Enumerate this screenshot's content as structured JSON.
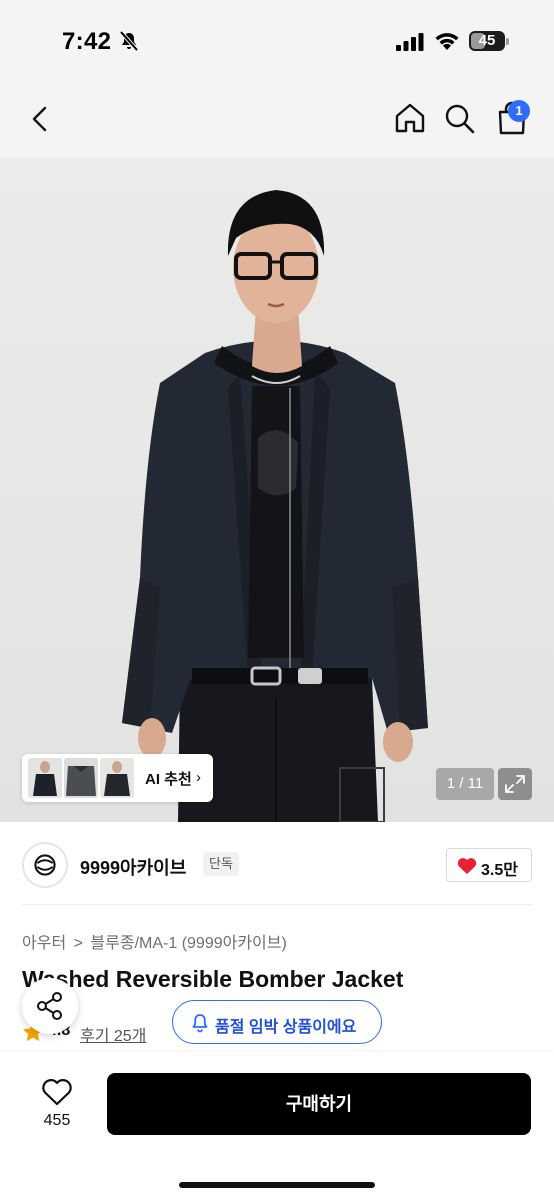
{
  "status_bar": {
    "time": "7:42",
    "battery": "45",
    "battery_level": 0.45,
    "icons": [
      "bell-slash-icon",
      "cellular-signal-icon",
      "wifi-icon",
      "battery-icon"
    ]
  },
  "header": {
    "icons": [
      "chevron-left-icon",
      "home-icon",
      "search-icon",
      "shopping-bag-icon"
    ],
    "cart_badge": "1"
  },
  "gallery": {
    "ai_label": "AI 추천",
    "ai_chevron": "›",
    "counter": "1 / 11",
    "thumbnail_count": 3
  },
  "brand": {
    "name": "9999아카이브",
    "tag": "단독",
    "like_count": "3.5만"
  },
  "breadcrumb": {
    "category": "아우터",
    "separator": ">",
    "subcategory": "블루종/MA-1 (9999아카이브)"
  },
  "product": {
    "title": "Washed Reversible Bomber Jacket",
    "rating": "4.8",
    "reviews": "후기 25개"
  },
  "stock_notice": {
    "label": "품절 임박 상품이에요"
  },
  "bottom_bar": {
    "wish_count": "455",
    "buy_label": "구매하기"
  },
  "colors": {
    "accent_blue": "#2f6bff",
    "heart_red": "#e8202f",
    "star_orange": "#f5a300",
    "buy_button": "#000000"
  }
}
